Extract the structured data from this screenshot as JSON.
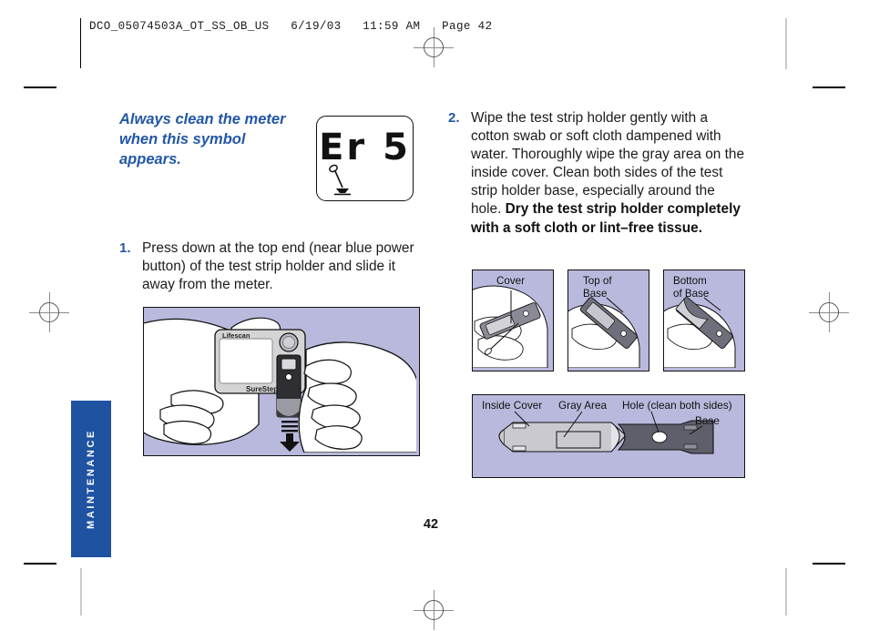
{
  "production": {
    "header_line": "DCO_05074503A_OT_SS_OB_US   6/19/03   11:59 AM   Page 42"
  },
  "side_tab": {
    "label": "MAINTENANCE",
    "color": "#1f52a0"
  },
  "left_column": {
    "lead_heading": "Always clean the meter when this symbol appears.",
    "lcd_display": {
      "value": "Er 5",
      "icon": "cleaning-swab-icon"
    },
    "step_1": {
      "number": "1.",
      "text": "Press down at the top end (near blue power button) of the test strip holder and slide it away from the meter."
    },
    "figure_main": {
      "name": "meter-strip-holder-removal",
      "brand_top": "Lifescan",
      "brand_bottom": "SureStep",
      "arrow": "down-arrow"
    }
  },
  "right_column": {
    "step_2": {
      "number": "2.",
      "text_normal": "Wipe the test strip holder gently with a cotton swab or soft cloth dampened with water. Thoroughly wipe the gray area on the inside cover. Clean both sides of the test strip holder base, especially around the hole. ",
      "text_bold": "Dry the test strip holder completely with a soft cloth or lint–free tissue."
    },
    "small_figures": [
      {
        "caption": "Cover",
        "caption_line2": ""
      },
      {
        "caption": "Top of",
        "caption_line2": "Base"
      },
      {
        "caption": "Bottom",
        "caption_line2": "of Base"
      }
    ],
    "bottom_figure": {
      "labels": {
        "inside_cover": "Inside Cover",
        "gray_area": "Gray Area",
        "hole": "Hole (clean both sides)",
        "base": "Base"
      }
    }
  },
  "footer": {
    "page_number": "42"
  },
  "colors": {
    "accent_blue": "#2257a5",
    "tab_blue": "#1f52a0",
    "panel_lavender": "#b9b9dd",
    "text": "#1c1c1c"
  }
}
